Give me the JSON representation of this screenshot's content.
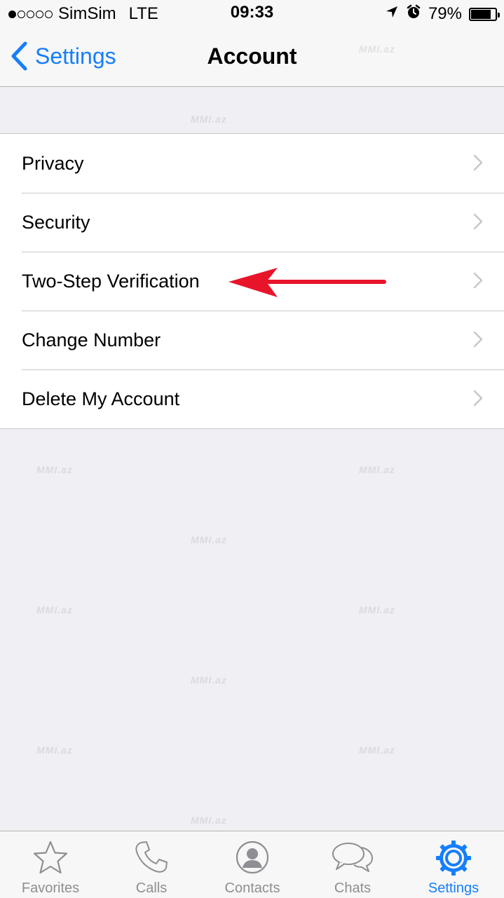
{
  "status_bar": {
    "carrier": "SimSim",
    "network": "LTE",
    "time": "09:33",
    "battery_text": "79%",
    "battery_level": 0.79,
    "signal_dots_filled": 1,
    "signal_dots_total": 5,
    "icons": [
      "location-arrow-icon",
      "alarm-icon",
      "battery-icon"
    ]
  },
  "nav": {
    "back_label": "Settings",
    "title": "Account"
  },
  "list": {
    "items": [
      {
        "label": "Privacy"
      },
      {
        "label": "Security"
      },
      {
        "label": "Two-Step Verification"
      },
      {
        "label": "Change Number"
      },
      {
        "label": "Delete My Account"
      }
    ]
  },
  "watermark": {
    "text": "MMI.az"
  },
  "tabbar": {
    "tabs": [
      {
        "label": "Favorites",
        "icon": "star-icon"
      },
      {
        "label": "Calls",
        "icon": "phone-icon"
      },
      {
        "label": "Contacts",
        "icon": "contact-icon"
      },
      {
        "label": "Chats",
        "icon": "chat-bubbles-icon"
      },
      {
        "label": "Settings",
        "icon": "gear-icon",
        "active": true
      }
    ]
  },
  "colors": {
    "accent": "#167efb",
    "background": "#efeff4",
    "annotation_arrow": "#e8142a",
    "inactive_tab": "#8e8e93"
  }
}
